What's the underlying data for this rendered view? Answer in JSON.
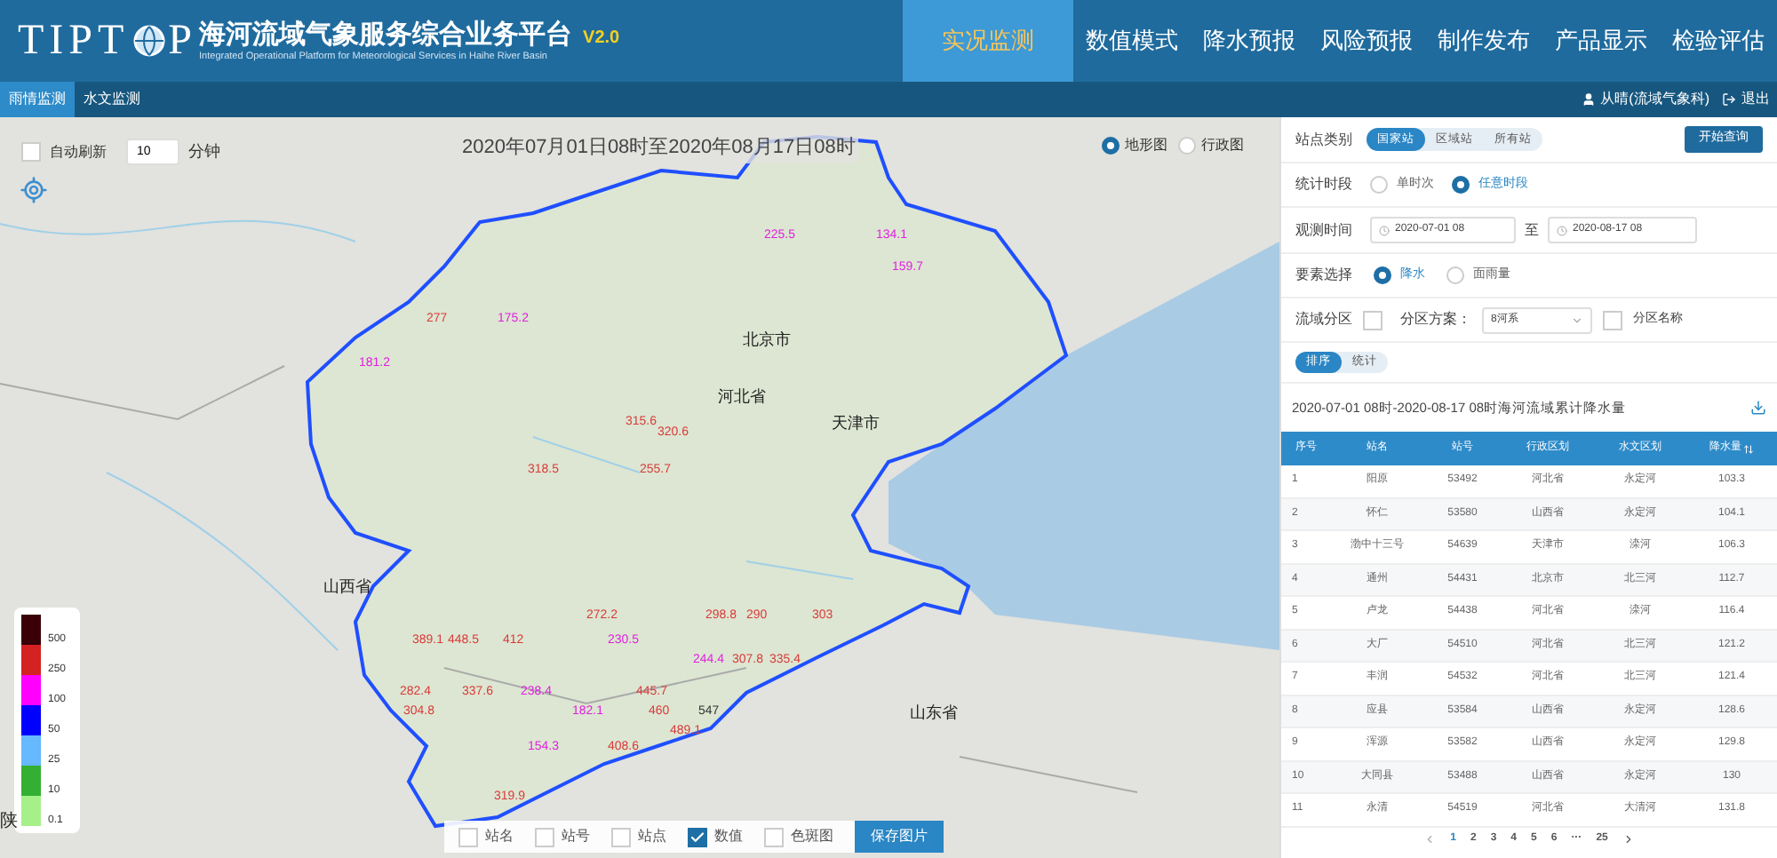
{
  "header": {
    "logo_prefix": "TIPT",
    "logo_suffix": "P",
    "title": "海河流域气象服务综合业务平台",
    "version": "V2.0",
    "subtitle": "Integrated Operational Platform for Meteorological Services in Haihe River Basin",
    "nav": [
      {
        "label": "实况监测",
        "selected": true
      },
      {
        "label": "数值模式",
        "selected": false
      },
      {
        "label": "降水预报",
        "selected": false
      },
      {
        "label": "风险预报",
        "selected": false
      },
      {
        "label": "制作发布",
        "selected": false
      },
      {
        "label": "产品显示",
        "selected": false
      },
      {
        "label": "检验评估",
        "selected": false
      }
    ]
  },
  "subbar": {
    "tabs": [
      {
        "label": "雨情监测",
        "selected": true
      },
      {
        "label": "水文监测",
        "selected": false
      }
    ],
    "user": "从晴(流域气象科)",
    "logout": "退出"
  },
  "map": {
    "auto_refresh": {
      "label": "自动刷新",
      "checked": false
    },
    "interval": "10",
    "interval_unit": "分钟",
    "time_title": "2020年07月01日08时至2020年08月17日08时",
    "base_layers": [
      {
        "label": "地形图",
        "selected": true
      },
      {
        "label": "行政图",
        "selected": false
      }
    ],
    "labels": [
      {
        "text": "225.5",
        "kind": "value",
        "color": "#e020e0"
      },
      {
        "text": "134.1",
        "kind": "value",
        "color": "#e020e0"
      },
      {
        "text": "159.7",
        "kind": "value",
        "color": "#e020e0"
      },
      {
        "text": "277",
        "kind": "value",
        "color": "#d83a3a"
      },
      {
        "text": "175.2",
        "kind": "value",
        "color": "#e020e0"
      },
      {
        "text": "北京市",
        "kind": "region",
        "color": "#222222"
      },
      {
        "text": "181.2",
        "kind": "value",
        "color": "#e020e0"
      },
      {
        "text": "河北省",
        "kind": "region",
        "color": "#222222"
      },
      {
        "text": "315.6",
        "kind": "value",
        "color": "#d83a3a"
      },
      {
        "text": "320.6",
        "kind": "value",
        "color": "#d83a3a"
      },
      {
        "text": "天津市",
        "kind": "region",
        "color": "#222222"
      },
      {
        "text": "318.5",
        "kind": "value",
        "color": "#d83a3a"
      },
      {
        "text": "255.7",
        "kind": "value",
        "color": "#d83a3a"
      },
      {
        "text": "山西省",
        "kind": "region",
        "color": "#222222"
      },
      {
        "text": "272.2",
        "kind": "value",
        "color": "#d83a3a"
      },
      {
        "text": "298.8",
        "kind": "value",
        "color": "#d83a3a"
      },
      {
        "text": "290",
        "kind": "value",
        "color": "#d83a3a"
      },
      {
        "text": "303",
        "kind": "value",
        "color": "#d83a3a"
      },
      {
        "text": "389.1",
        "kind": "value",
        "color": "#d83a3a"
      },
      {
        "text": "448.5",
        "kind": "value",
        "color": "#d83a3a"
      },
      {
        "text": "412",
        "kind": "value",
        "color": "#d83a3a"
      },
      {
        "text": "230.5",
        "kind": "value",
        "color": "#e020e0"
      },
      {
        "text": "244.4",
        "kind": "value",
        "color": "#e020e0"
      },
      {
        "text": "307.8",
        "kind": "value",
        "color": "#d83a3a"
      },
      {
        "text": "335.4",
        "kind": "value",
        "color": "#d83a3a"
      },
      {
        "text": "282.4",
        "kind": "value",
        "color": "#d83a3a"
      },
      {
        "text": "337.6",
        "kind": "value",
        "color": "#d83a3a"
      },
      {
        "text": "238.4",
        "kind": "value",
        "color": "#e020e0"
      },
      {
        "text": "445.7",
        "kind": "value",
        "color": "#d83a3a"
      },
      {
        "text": "304.8",
        "kind": "value",
        "color": "#d83a3a"
      },
      {
        "text": "182.1",
        "kind": "value",
        "color": "#e020e0"
      },
      {
        "text": "460",
        "kind": "value",
        "color": "#d83a3a"
      },
      {
        "text": "547",
        "kind": "value",
        "color": "#333333"
      },
      {
        "text": "山东省",
        "kind": "region",
        "color": "#222222"
      },
      {
        "text": "489.1",
        "kind": "value",
        "color": "#d83a3a"
      },
      {
        "text": "154.3",
        "kind": "value",
        "color": "#e020e0"
      },
      {
        "text": "408.6",
        "kind": "value",
        "color": "#d83a3a"
      },
      {
        "text": "319.9",
        "kind": "value",
        "color": "#d83a3a"
      }
    ],
    "legend": [
      {
        "label": "500",
        "color": "#3a0008"
      },
      {
        "label": "250",
        "color": "#d42222"
      },
      {
        "label": "100",
        "color": "#ff00ff"
      },
      {
        "label": "50",
        "color": "#0000ff"
      },
      {
        "label": "25",
        "color": "#66b8ff"
      },
      {
        "label": "10",
        "color": "#33b033"
      },
      {
        "label": "0.1",
        "color": "#a6f08a"
      }
    ],
    "edge_text": "陕",
    "display_options": [
      {
        "label": "站名",
        "checked": false
      },
      {
        "label": "站号",
        "checked": false
      },
      {
        "label": "站点",
        "checked": false
      },
      {
        "label": "数值",
        "checked": true
      },
      {
        "label": "色斑图",
        "checked": false
      }
    ],
    "save_button": "保存图片"
  },
  "panel": {
    "station_type": {
      "label": "站点类别",
      "options": [
        {
          "label": "国家站",
          "selected": true
        },
        {
          "label": "区域站",
          "selected": false
        },
        {
          "label": "所有站",
          "selected": false
        }
      ]
    },
    "query_button": "开始查询",
    "period": {
      "label": "统计时段",
      "options": [
        {
          "label": "单时次",
          "selected": false
        },
        {
          "label": "任意时段",
          "selected": true
        }
      ]
    },
    "obs_time": {
      "label": "观测时间",
      "start": "2020-07-01 08",
      "separator": "至",
      "end": "2020-08-17 08"
    },
    "element": {
      "label": "要素选择",
      "options": [
        {
          "label": "降水",
          "selected": true
        },
        {
          "label": "面雨量",
          "selected": false
        }
      ]
    },
    "basin": {
      "label": "流域分区",
      "checked": false,
      "scheme_label": "分区方案：",
      "scheme_value": "8河系",
      "name_label": "分区名称",
      "name_checked": false
    },
    "view_tabs": [
      {
        "label": "排序",
        "selected": true
      },
      {
        "label": "统计",
        "selected": false
      }
    ],
    "table_title": "2020-07-01 08时-2020-08-17 08时海河流域累计降水量",
    "columns": [
      "序号",
      "站名",
      "站号",
      "行政区划",
      "水文区划",
      "降水量"
    ],
    "rows": [
      [
        "1",
        "阳原",
        "53492",
        "河北省",
        "永定河",
        "103.3"
      ],
      [
        "2",
        "怀仁",
        "53580",
        "山西省",
        "永定河",
        "104.1"
      ],
      [
        "3",
        "渤中十三号",
        "54639",
        "天津市",
        "滦河",
        "106.3"
      ],
      [
        "4",
        "通州",
        "54431",
        "北京市",
        "北三河",
        "112.7"
      ],
      [
        "5",
        "卢龙",
        "54438",
        "河北省",
        "滦河",
        "116.4"
      ],
      [
        "6",
        "大厂",
        "54510",
        "河北省",
        "北三河",
        "121.2"
      ],
      [
        "7",
        "丰润",
        "54532",
        "河北省",
        "北三河",
        "121.4"
      ],
      [
        "8",
        "应县",
        "53584",
        "山西省",
        "永定河",
        "128.6"
      ],
      [
        "9",
        "浑源",
        "53582",
        "山西省",
        "永定河",
        "129.8"
      ],
      [
        "10",
        "大同县",
        "53488",
        "山西省",
        "永定河",
        "130"
      ],
      [
        "11",
        "永清",
        "54519",
        "河北省",
        "大清河",
        "131.8"
      ]
    ],
    "pages": [
      {
        "label": "1",
        "selected": true
      },
      {
        "label": "2",
        "selected": false
      },
      {
        "label": "3",
        "selected": false
      },
      {
        "label": "4",
        "selected": false
      },
      {
        "label": "5",
        "selected": false
      },
      {
        "label": "6",
        "selected": false
      },
      {
        "label": "···",
        "selected": false
      },
      {
        "label": "25",
        "selected": false
      }
    ]
  }
}
